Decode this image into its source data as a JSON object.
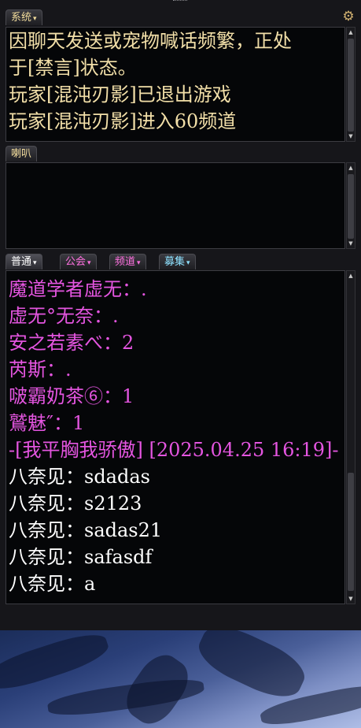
{
  "system_tab": {
    "label": "系统",
    "caret": "▾"
  },
  "system_messages": [
    "因聊天发送或宠物喊话频繁，正处",
    "于[禁言]状态。",
    "玩家[混沌刃影]已退出游戏",
    "玩家[混沌刃影]进入60频道"
  ],
  "horn_tab": {
    "label": "喇叭"
  },
  "chat_tabs": [
    {
      "label": "普通",
      "caret": "▾"
    },
    {
      "label": "公会",
      "caret": "▾"
    },
    {
      "label": "频道",
      "caret": "▾"
    },
    {
      "label": "募集",
      "caret": "▾"
    }
  ],
  "chat_messages": [
    {
      "text": "魔道学者虚无：.",
      "color": "#e455e0"
    },
    {
      "text": "虚无°无奈：.",
      "color": "#e455e0"
    },
    {
      "text": "安之若素べ：2",
      "color": "#e455e0"
    },
    {
      "text": "芮斯：.",
      "color": "#e455e0"
    },
    {
      "text": "啵霸奶茶⑥：1",
      "color": "#e455e0"
    },
    {
      "text": "鷲魅″：1",
      "color": "#e455e0"
    },
    {
      "text": "-[我平胸我骄傲] [2025.04.25 16:19]-",
      "color": "#e455e0"
    },
    {
      "text": "八奈见：sdadas",
      "color": "#ffffff"
    },
    {
      "text": "八奈见：s2123",
      "color": "#ffffff"
    },
    {
      "text": "八奈见：sadas21",
      "color": "#ffffff"
    },
    {
      "text": "八奈见：safasdf",
      "color": "#ffffff"
    },
    {
      "text": "八奈见：a",
      "color": "#ffffff"
    }
  ],
  "icons": {
    "settings": "gear-icon",
    "scroll_up": "arrow-up-icon",
    "scroll_down": "arrow-down-icon"
  }
}
